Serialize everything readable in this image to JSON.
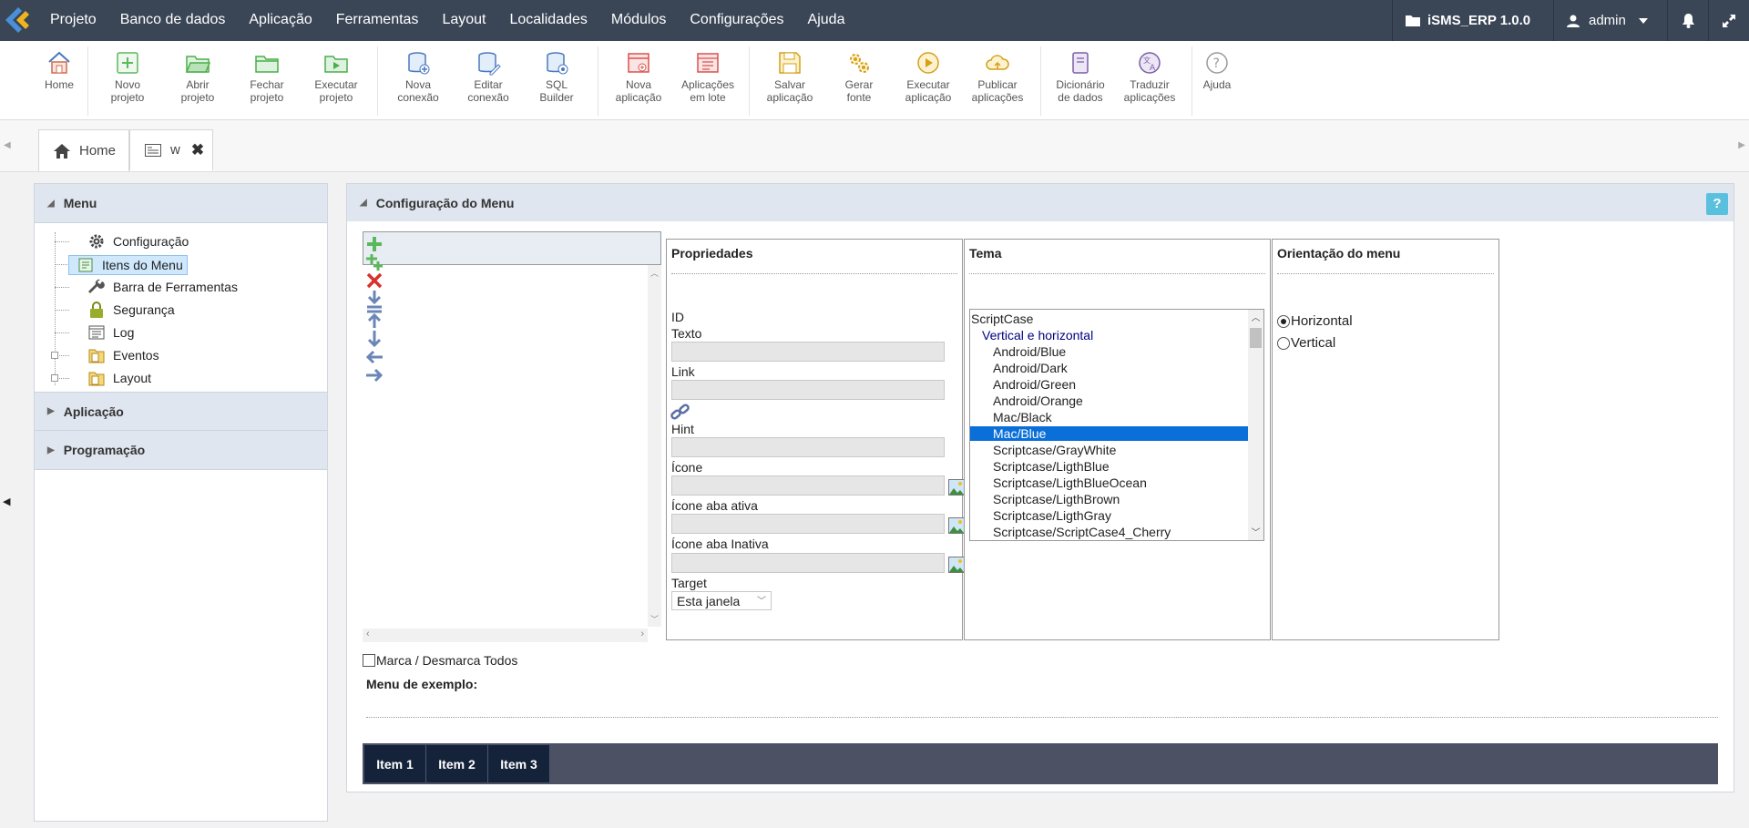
{
  "topbar": {
    "menu": [
      "Projeto",
      "Banco de dados",
      "Aplicação",
      "Ferramentas",
      "Layout",
      "Localidades",
      "Módulos",
      "Configurações",
      "Ajuda"
    ],
    "project": "iSMS_ERP 1.0.0",
    "user": "admin",
    "colors": {
      "bar": "#3a4556",
      "logo_blue": "#4a90d9",
      "logo_yellow": "#f0b51e"
    }
  },
  "toolbar": {
    "home": "Home",
    "novo": [
      "Novo",
      "projeto"
    ],
    "abrir": [
      "Abrir",
      "projeto"
    ],
    "fechar": [
      "Fechar",
      "projeto"
    ],
    "executar_proj": [
      "Executar",
      "projeto"
    ],
    "nova_con": [
      "Nova",
      "conexão"
    ],
    "editar_con": [
      "Editar",
      "conexão"
    ],
    "sql": [
      "SQL",
      "Builder"
    ],
    "nova_app": [
      "Nova",
      "aplicação"
    ],
    "apps_lote": [
      "Aplicações",
      "em lote"
    ],
    "salvar": [
      "Salvar",
      "aplicação"
    ],
    "gerar": [
      "Gerar",
      "fonte"
    ],
    "executar_app": [
      "Executar",
      "aplicação"
    ],
    "publicar": [
      "Publicar",
      "aplicações"
    ],
    "dicionario": [
      "Dicionário",
      "de dados"
    ],
    "traduzir": [
      "Traduzir",
      "aplicações"
    ],
    "ajuda": "Ajuda"
  },
  "tabs": {
    "home": "Home",
    "w": "w"
  },
  "left": {
    "menu_title": "Menu",
    "items": [
      "Configuração",
      "Itens do Menu",
      "Barra de Ferramentas",
      "Segurança",
      "Log",
      "Eventos",
      "Layout"
    ],
    "aplicacao": "Aplicação",
    "programacao": "Programação"
  },
  "main": {
    "title": "Configuração do Menu",
    "help": "?",
    "props": {
      "title": "Propriedades",
      "id": "ID",
      "texto": "Texto",
      "link": "Link",
      "hint": "Hint",
      "icone": "Ícone",
      "icone_ativa": "Ícone aba ativa",
      "icone_inativa": "Ícone aba Inativa",
      "target": "Target",
      "target_value": "Esta janela"
    },
    "tema": {
      "title": "Tema",
      "root": "ScriptCase",
      "group": "Vertical e horizontal",
      "options": [
        "Android/Blue",
        "Android/Dark",
        "Android/Green",
        "Android/Orange",
        "Mac/Black",
        "Mac/Blue",
        "Scriptcase/GrayWhite",
        "Scriptcase/LigthBlue",
        "Scriptcase/LigthBlueOcean",
        "Scriptcase/LigthBrown",
        "Scriptcase/LigthGray",
        "Scriptcase/ScriptCase4_Cherry"
      ],
      "selected": "Mac/Blue"
    },
    "orient": {
      "title": "Orientação do menu",
      "horizontal": "Horizontal",
      "vertical": "Vertical",
      "selected": "Horizontal"
    },
    "marca": "Marca / Desmarca Todos",
    "exemplo": "Menu de exemplo:",
    "sample_items": [
      "Item 1",
      "Item 2",
      "Item 3"
    ]
  }
}
